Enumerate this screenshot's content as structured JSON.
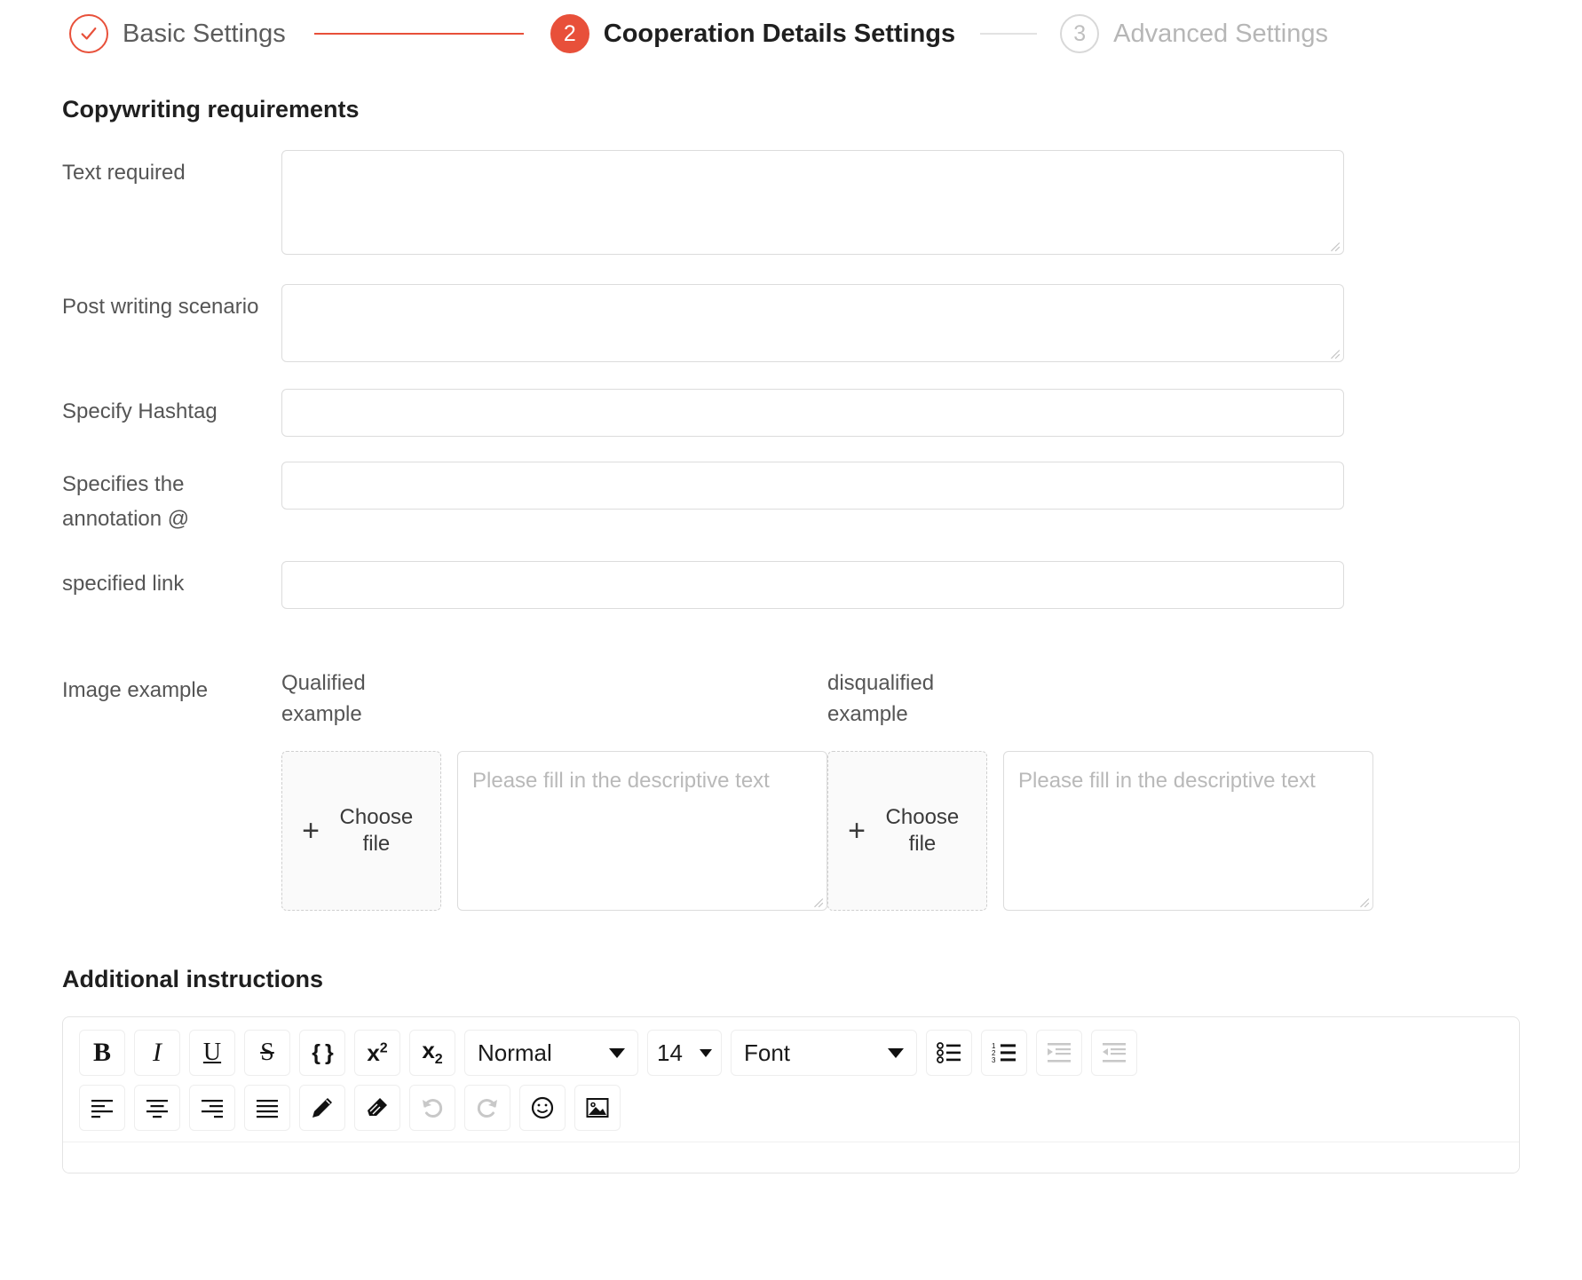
{
  "stepper": {
    "steps": [
      {
        "badge": "check-icon",
        "label": "Basic Settings",
        "state": "done"
      },
      {
        "badge": "2",
        "label": "Cooperation Details Settings",
        "state": "active"
      },
      {
        "badge": "3",
        "label": "Advanced Settings",
        "state": "todo"
      }
    ],
    "accent_color": "#e8503a",
    "inactive_color": "#b6b6b6"
  },
  "copywriting": {
    "title": "Copywriting requirements",
    "fields": [
      {
        "label": "Text required",
        "value": "",
        "placeholder": "",
        "type": "textarea-large"
      },
      {
        "label": "Post writing scenario",
        "value": "",
        "placeholder": "",
        "type": "textarea-medium"
      },
      {
        "label": "Specify Hashtag",
        "value": "",
        "placeholder": "",
        "type": "input"
      },
      {
        "label": "Specifies the annotation @",
        "value": "",
        "placeholder": "",
        "type": "input"
      },
      {
        "label": "specified link",
        "value": "",
        "placeholder": "",
        "type": "input"
      }
    ]
  },
  "image_example": {
    "label": "Image example",
    "qualified": {
      "title": "Qualified example",
      "upload_label": "Choose file",
      "upload_icon": "plus-icon",
      "description_placeholder": "Please fill in the descriptive text",
      "description_value": ""
    },
    "disqualified": {
      "title": "disqualified example",
      "upload_label": "Choose file",
      "upload_icon": "plus-icon",
      "description_placeholder": "Please fill in the descriptive text",
      "description_value": ""
    }
  },
  "additional": {
    "title": "Additional instructions",
    "toolbar": {
      "row1": [
        {
          "name": "bold-icon",
          "glyph": "B",
          "kind": "bold",
          "disabled": false
        },
        {
          "name": "italic-icon",
          "glyph": "I",
          "kind": "italic",
          "disabled": false
        },
        {
          "name": "underline-icon",
          "glyph": "U",
          "kind": "underline",
          "disabled": false
        },
        {
          "name": "strikethrough-icon",
          "glyph": "S",
          "kind": "strike",
          "disabled": false
        },
        {
          "name": "code-block-icon",
          "glyph": "{}",
          "kind": "code",
          "disabled": false
        },
        {
          "name": "superscript-icon",
          "glyph": "x2",
          "kind": "sup",
          "disabled": false
        },
        {
          "name": "subscript-icon",
          "glyph": "x2",
          "kind": "sub",
          "disabled": false
        }
      ],
      "heading_select": {
        "name": "heading-select",
        "value": "Normal"
      },
      "size_select": {
        "name": "font-size-select",
        "value": "14"
      },
      "font_select": {
        "name": "font-family-select",
        "value": "Font"
      },
      "row1_end": [
        {
          "name": "bullet-list-icon",
          "disabled": false
        },
        {
          "name": "numbered-list-icon",
          "disabled": false
        },
        {
          "name": "indent-increase-icon",
          "disabled": true
        },
        {
          "name": "indent-decrease-icon",
          "disabled": true
        }
      ],
      "row2": [
        {
          "name": "align-left-icon",
          "disabled": false
        },
        {
          "name": "align-center-icon",
          "disabled": false
        },
        {
          "name": "align-right-icon",
          "disabled": false
        },
        {
          "name": "align-justify-icon",
          "disabled": false
        },
        {
          "name": "pen-icon",
          "disabled": false
        },
        {
          "name": "eraser-icon",
          "disabled": false
        },
        {
          "name": "undo-icon",
          "disabled": true
        },
        {
          "name": "redo-icon",
          "disabled": true
        },
        {
          "name": "emoji-icon",
          "disabled": false
        },
        {
          "name": "image-icon",
          "disabled": false
        }
      ]
    },
    "content": ""
  }
}
